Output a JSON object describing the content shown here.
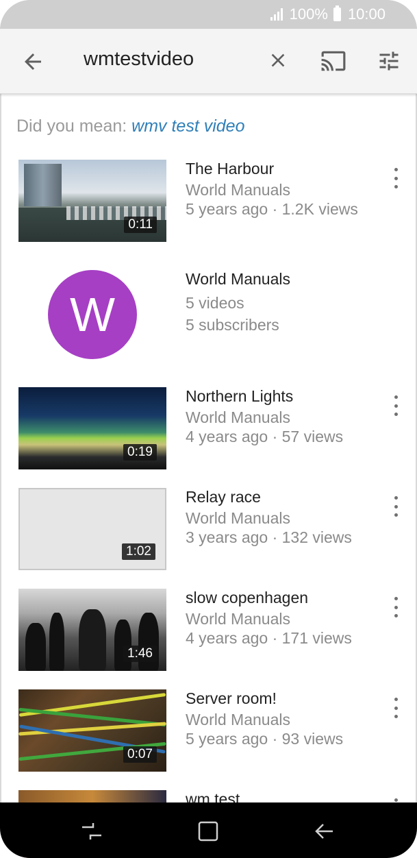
{
  "status_bar": {
    "battery": "100%",
    "time": "10:00"
  },
  "search": {
    "query": "wmtestvideo"
  },
  "did_you_mean": {
    "label": "Did you mean:",
    "suggestion": "wmv test video"
  },
  "results": [
    {
      "title": "The Harbour",
      "channel": "World Manuals",
      "meta": "5 years ago · 1.2K views",
      "duration": "0:11"
    },
    {
      "channel_name": "World Manuals",
      "initial": "W",
      "videos": "5 videos",
      "subscribers": "5 subscribers",
      "avatar_color": "#a63fc4"
    },
    {
      "title": "Northern Lights",
      "channel": "World Manuals",
      "meta": "4 years ago · 57 views",
      "duration": "0:19"
    },
    {
      "title": "Relay race",
      "channel": "World Manuals",
      "meta": "3 years ago · 132 views",
      "duration": "1:02"
    },
    {
      "title": "slow copenhagen",
      "channel": "World Manuals",
      "meta": "4 years ago · 171 views",
      "duration": "1:46"
    },
    {
      "title": "Server room!",
      "channel": "World Manuals",
      "meta": "5 years ago · 93 views",
      "duration": "0:07"
    },
    {
      "title": "wm test"
    }
  ],
  "colors": {
    "accent_link": "#2f7fb8",
    "search_bar_bg": "#f4f4f4",
    "status_bar_bg": "#cfcfcf"
  }
}
